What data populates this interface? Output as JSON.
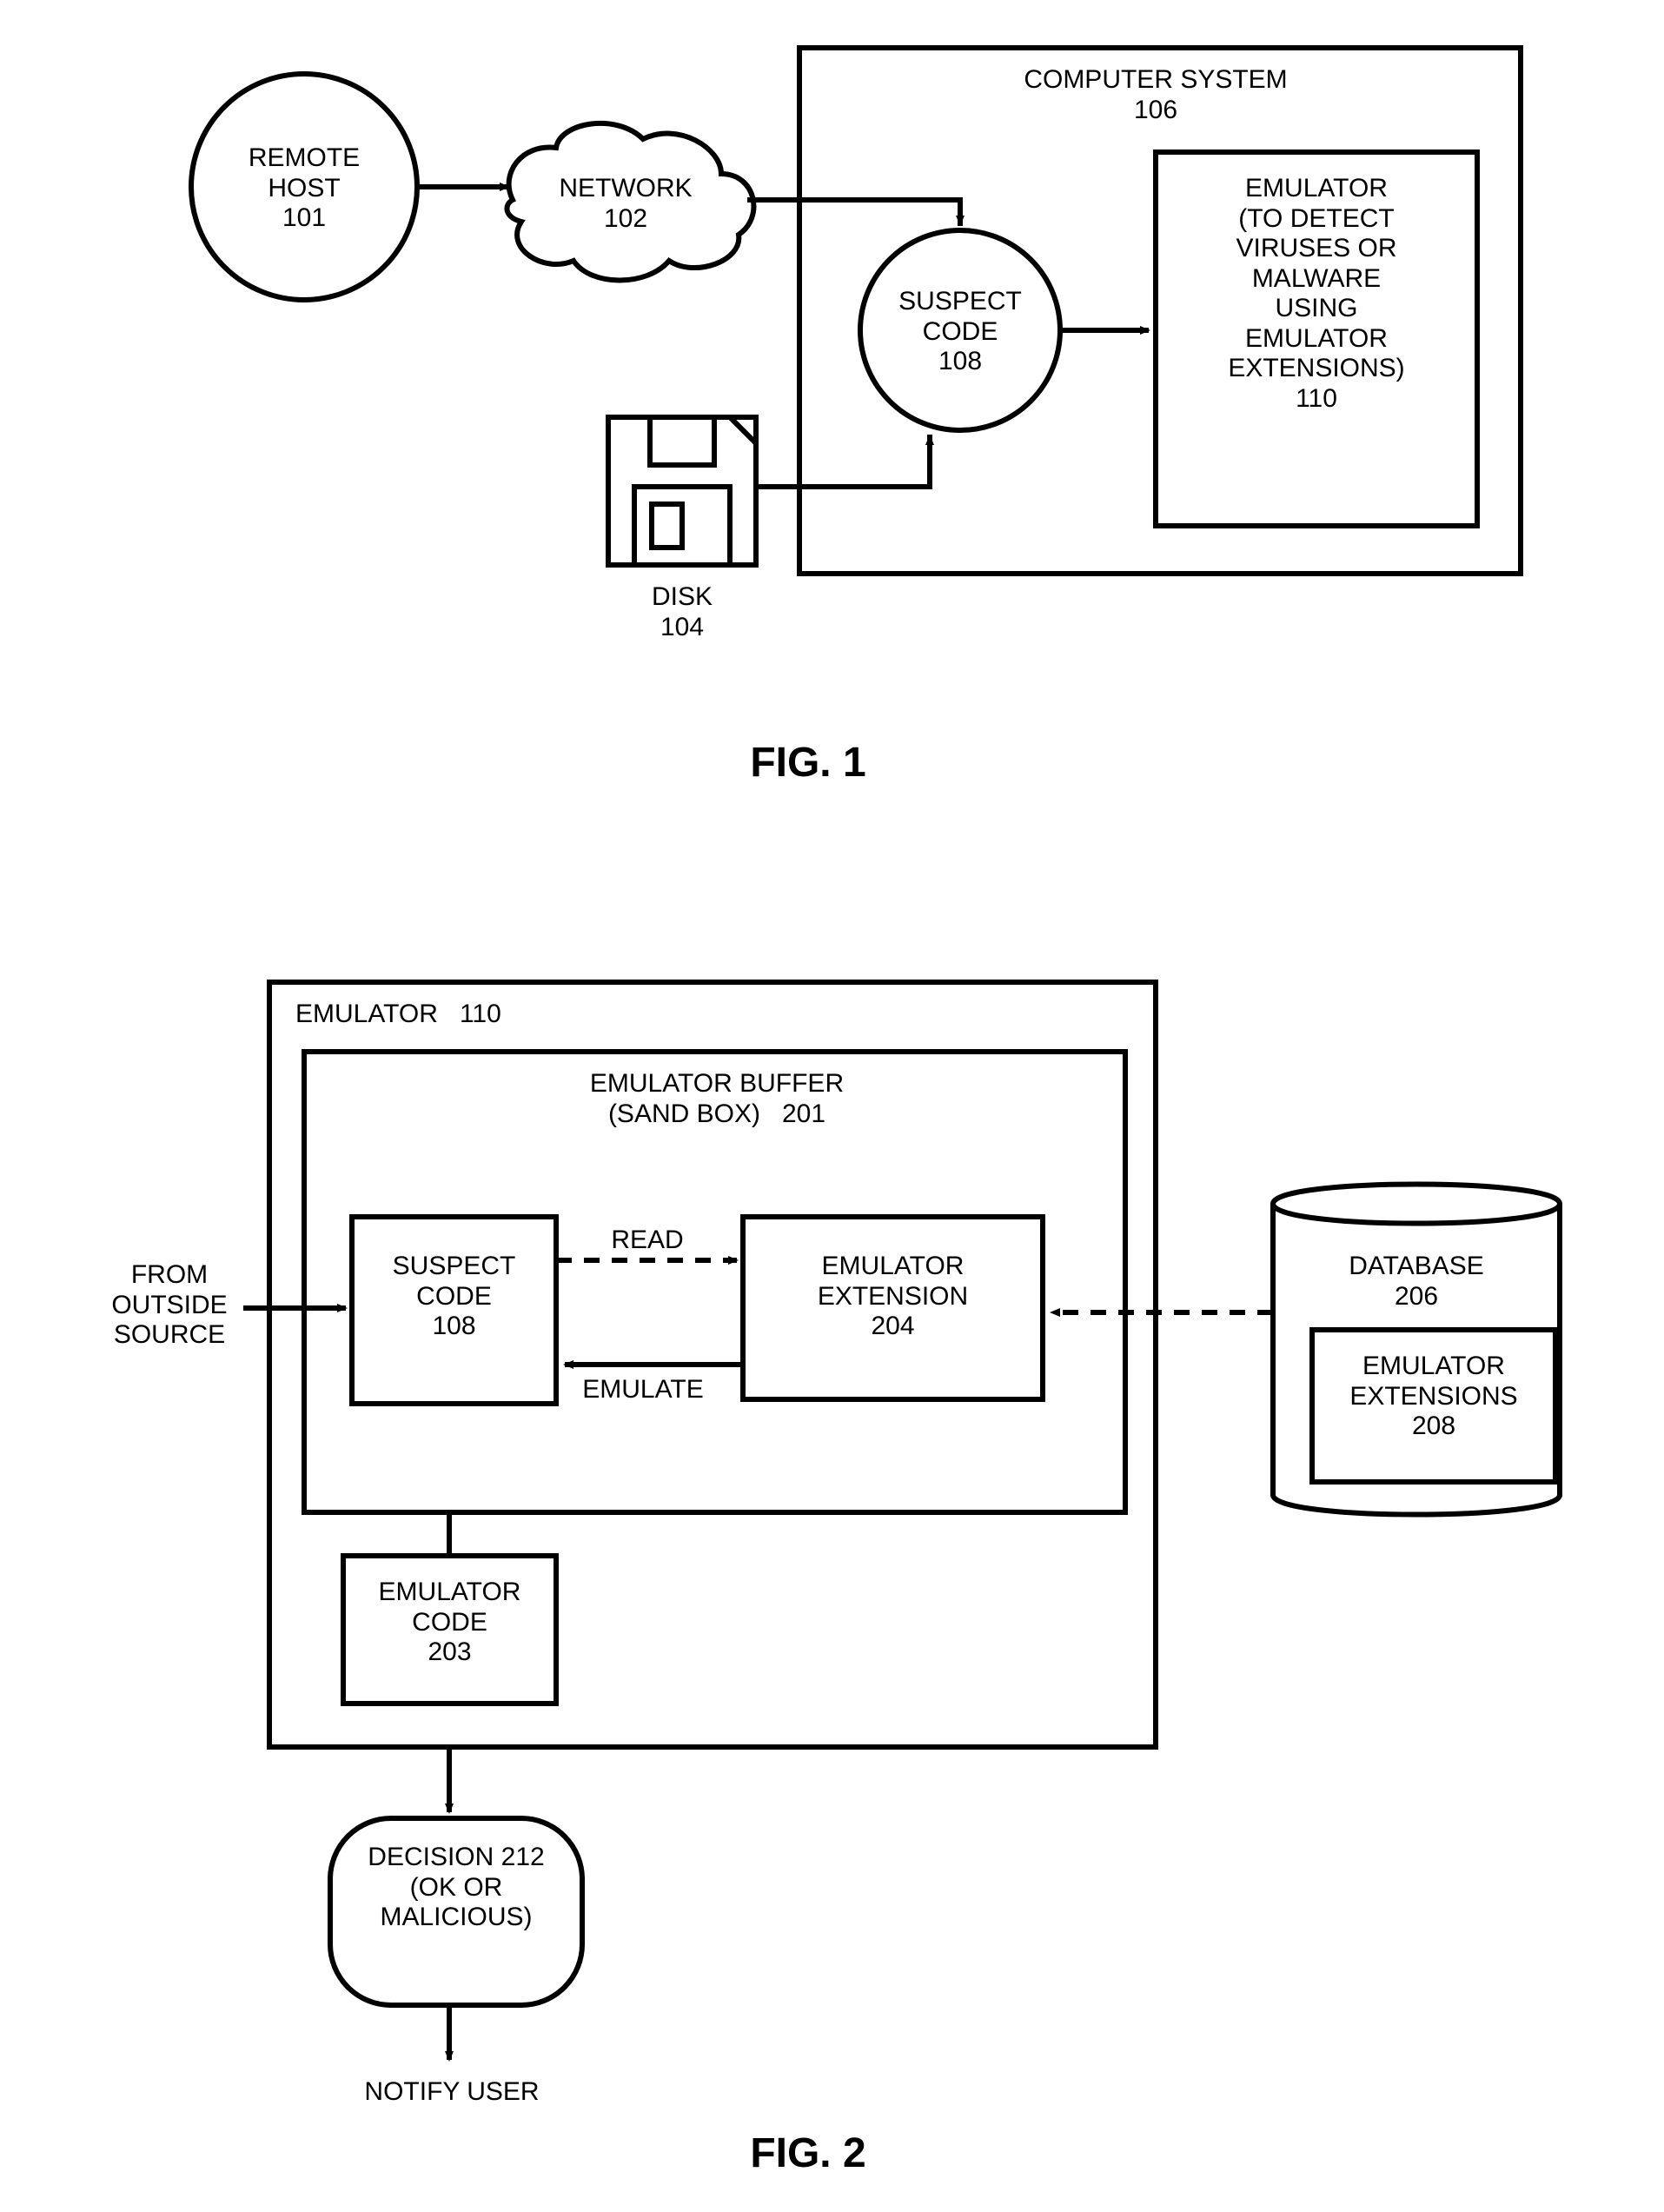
{
  "fig1": {
    "caption": "FIG. 1",
    "remoteHost": {
      "line1": "REMOTE",
      "line2": "HOST",
      "num": "101"
    },
    "network": {
      "line1": "NETWORK",
      "num": "102"
    },
    "disk": {
      "line1": "DISK",
      "num": "104"
    },
    "computerSystem": {
      "line1": "COMPUTER SYSTEM",
      "num": "106"
    },
    "suspectCode": {
      "line1": "SUSPECT",
      "line2": "CODE",
      "num": "108"
    },
    "emulator": {
      "line1": "EMULATOR",
      "line2": "(TO DETECT",
      "line3": "VIRUSES OR",
      "line4": "MALWARE",
      "line5": "USING",
      "line6": "EMULATOR",
      "line7": "EXTENSIONS)",
      "num": "110"
    }
  },
  "fig2": {
    "caption": "FIG. 2",
    "emulator": {
      "line1": "EMULATOR",
      "num": "110"
    },
    "sandbox": {
      "line1": "EMULATOR BUFFER",
      "line2": "(SAND BOX)",
      "num": "201"
    },
    "suspectCode": {
      "line1": "SUSPECT",
      "line2": "CODE",
      "num": "108"
    },
    "emuExt": {
      "line1": "EMULATOR",
      "line2": "EXTENSION",
      "num": "204"
    },
    "read": "READ",
    "emulate": "EMULATE",
    "fromOutside": {
      "line1": "FROM",
      "line2": "OUTSIDE",
      "line3": "SOURCE"
    },
    "emuCode": {
      "line1": "EMULATOR",
      "line2": "CODE",
      "num": "203"
    },
    "database": {
      "line1": "DATABASE",
      "num": "206"
    },
    "emuExts": {
      "line1": "EMULATOR",
      "line2": "EXTENSIONS",
      "num": "208"
    },
    "decision": {
      "line1": "DECISION",
      "num": "212",
      "line2": "(OK OR",
      "line3": "MALICIOUS)"
    },
    "notify": "NOTIFY USER"
  }
}
